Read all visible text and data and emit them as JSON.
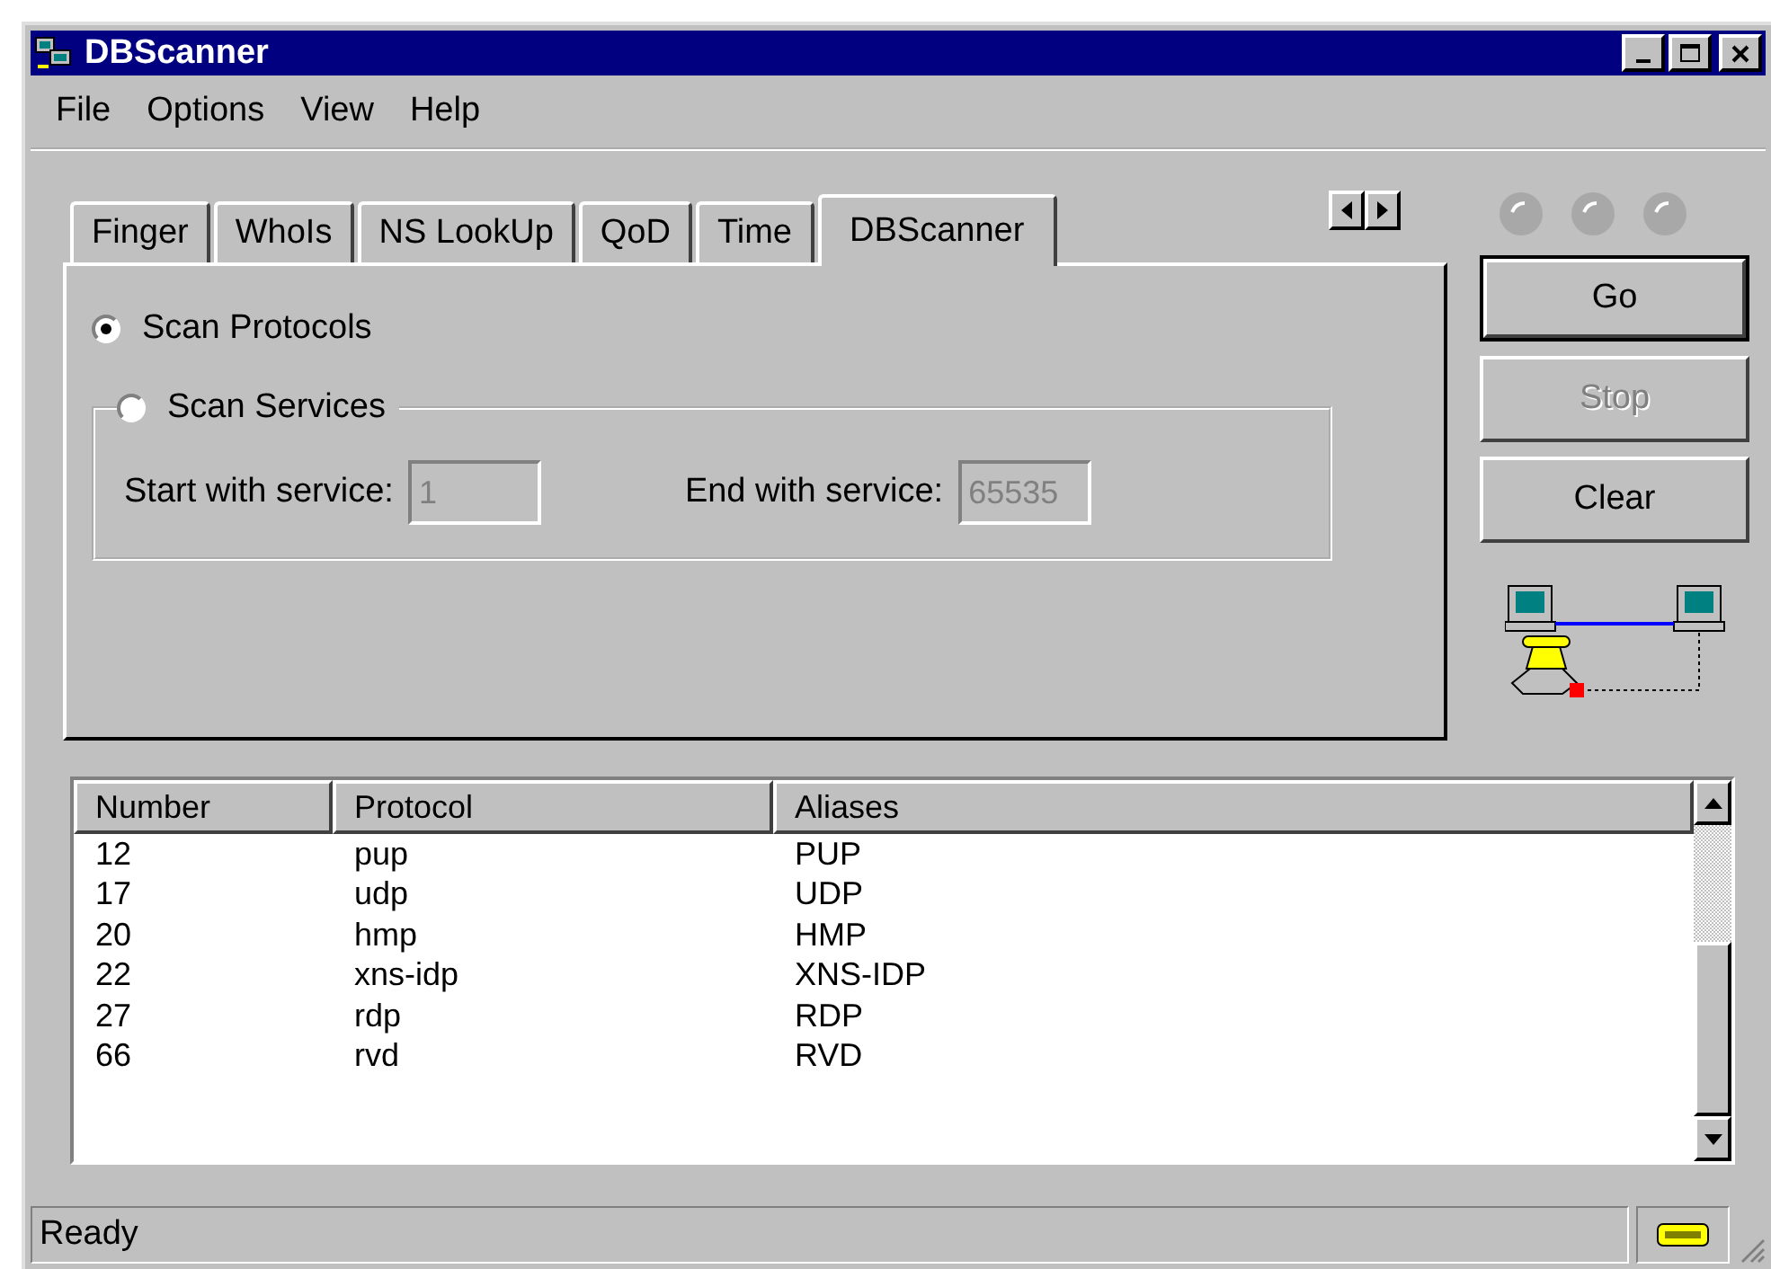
{
  "window": {
    "title": "DBScanner"
  },
  "menu": [
    "File",
    "Options",
    "View",
    "Help"
  ],
  "tabs": [
    {
      "label": "Finger",
      "selected": false
    },
    {
      "label": "WhoIs",
      "selected": false
    },
    {
      "label": "NS LookUp",
      "selected": false
    },
    {
      "label": "QoD",
      "selected": false
    },
    {
      "label": "Time",
      "selected": false
    },
    {
      "label": "DBScanner",
      "selected": true
    }
  ],
  "options": [
    {
      "label": "Scan Protocols",
      "selected": true
    },
    {
      "label": "Scan Services",
      "selected": false
    }
  ],
  "service_range": [
    {
      "label": "Start with service:",
      "value": "1",
      "disabled": true
    },
    {
      "label": "End with service:",
      "value": "65535",
      "disabled": true
    }
  ],
  "buttons": [
    {
      "label": "Go",
      "default": true,
      "disabled": false
    },
    {
      "label": "Stop",
      "default": false,
      "disabled": true
    },
    {
      "label": "Clear",
      "default": false,
      "disabled": false
    }
  ],
  "table": {
    "columns": [
      "Number",
      "Protocol",
      "Aliases"
    ],
    "rows": [
      [
        "12",
        "pup",
        "PUP"
      ],
      [
        "17",
        "udp",
        "UDP"
      ],
      [
        "20",
        "hmp",
        "HMP"
      ],
      [
        "22",
        "xns-idp",
        "XNS-IDP"
      ],
      [
        "27",
        "rdp",
        "RDP"
      ],
      [
        "66",
        "rvd",
        "RVD"
      ]
    ]
  },
  "status_bar": {
    "text": "Ready"
  }
}
